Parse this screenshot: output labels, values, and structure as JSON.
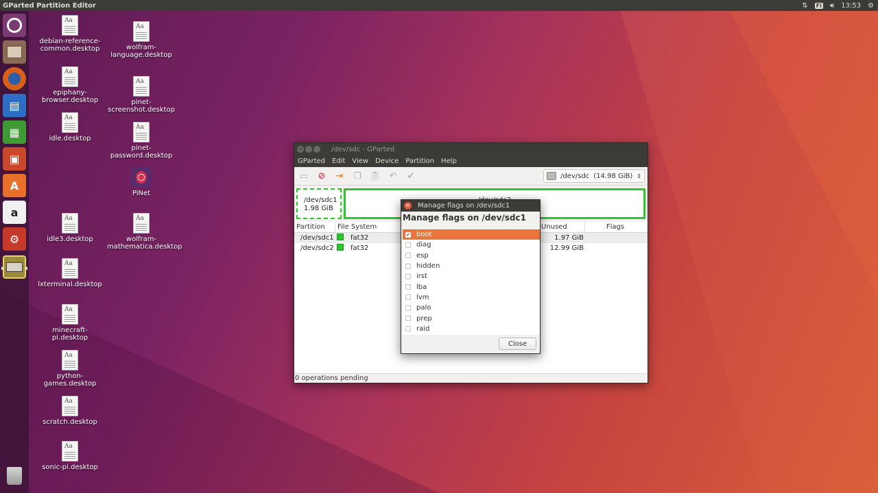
{
  "top_panel": {
    "app_title": "GParted Partition Editor",
    "keyboard_layout": "Fi",
    "time": "13:53"
  },
  "launcher": {
    "items": [
      "ubuntu-dash-icon",
      "files-icon",
      "firefox-icon",
      "writer-icon",
      "calc-icon",
      "impress-icon",
      "software-center-icon",
      "amazon-icon",
      "system-settings-icon",
      "gparted-icon"
    ],
    "trash": "trash-icon"
  },
  "desktop_icons": {
    "col1": [
      "debian-reference-common.desktop",
      "epiphany-browser.desktop",
      "idle.desktop",
      "idle3.desktop",
      "lxterminal.desktop",
      "minecraft-pi.desktop",
      "python-games.desktop",
      "scratch.desktop",
      "sonic-pi.desktop"
    ],
    "col2": [
      "wolfram-language.desktop",
      "pinet-screenshot.desktop",
      "pinet-password.desktop",
      "PiNet",
      "wolfram-mathematica.desktop"
    ]
  },
  "gparted": {
    "window_title": "/dev/sdc - GParted",
    "menu": [
      "GParted",
      "Edit",
      "View",
      "Device",
      "Partition",
      "Help"
    ],
    "device": "/dev/sdc",
    "device_size": "(14.98 GiB)",
    "graph": {
      "p1_name": "/dev/sdc1",
      "p1_size": "1.98 GiB",
      "p2_name": "/dev/sdc2"
    },
    "columns": {
      "partition": "Partition",
      "filesystem": "File System",
      "unused": "Unused",
      "flags": "Flags"
    },
    "rows": [
      {
        "partition": "/dev/sdc1",
        "fs": "fat32",
        "unused": "1.97 GiB"
      },
      {
        "partition": "/dev/sdc2",
        "fs": "fat32",
        "unused": "12.99 GiB"
      }
    ],
    "status": "0 operations pending"
  },
  "dialog": {
    "title": "Manage flags on /dev/sdc1",
    "heading": "Manage flags on /dev/sdc1",
    "flags": [
      {
        "name": "boot",
        "checked": true
      },
      {
        "name": "diag",
        "checked": false
      },
      {
        "name": "esp",
        "checked": false
      },
      {
        "name": "hidden",
        "checked": false
      },
      {
        "name": "irst",
        "checked": false
      },
      {
        "name": "lba",
        "checked": false
      },
      {
        "name": "lvm",
        "checked": false
      },
      {
        "name": "palo",
        "checked": false
      },
      {
        "name": "prep",
        "checked": false
      },
      {
        "name": "raid",
        "checked": false
      }
    ],
    "close_label": "Close"
  },
  "colors": {
    "panel": "#3c3b37",
    "selection": "#e9753a",
    "partition_green": "#2ec62e",
    "gparted_red": "#c8202b"
  }
}
